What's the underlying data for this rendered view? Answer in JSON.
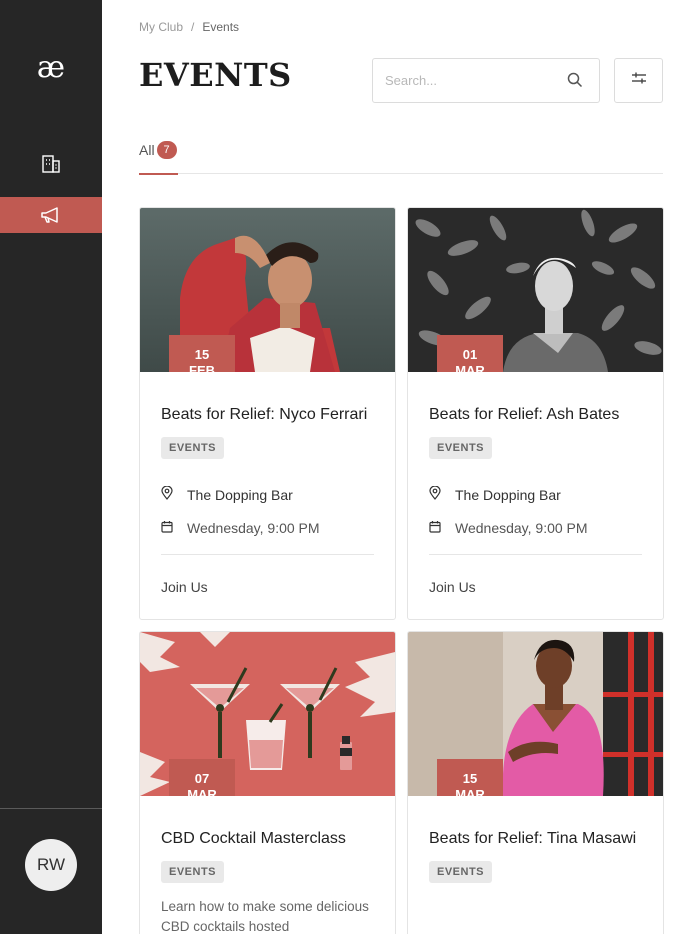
{
  "sidebar": {
    "logo": "æ",
    "nav": [
      {
        "id": "club",
        "icon": "building-icon",
        "active": false
      },
      {
        "id": "events",
        "icon": "megaphone-icon",
        "active": true
      }
    ],
    "avatar_initials": "RW"
  },
  "breadcrumb": {
    "parent": "My Club",
    "separator": "/",
    "current": "Events"
  },
  "header": {
    "title": "EVENTS"
  },
  "search": {
    "placeholder": "Search..."
  },
  "tabs": [
    {
      "label": "All",
      "count": "7",
      "active": true
    }
  ],
  "accent_color": "#c05a52",
  "cards": [
    {
      "day": "15",
      "month": "FEB",
      "title": "Beats for Relief: Nyco Ferrari",
      "tag": "EVENTS",
      "location": "The Dopping Bar",
      "time": "Wednesday, 9:00 PM",
      "cta": "Join Us"
    },
    {
      "day": "01",
      "month": "MAR",
      "title": "Beats for Relief: Ash Bates",
      "tag": "EVENTS",
      "location": "The Dopping Bar",
      "time": "Wednesday, 9:00 PM",
      "cta": "Join Us"
    },
    {
      "day": "07",
      "month": "MAR",
      "title": "CBD Cocktail Masterclass",
      "tag": "EVENTS",
      "description": "Learn how to make some delicious CBD cocktails hosted"
    },
    {
      "day": "15",
      "month": "MAR",
      "title": "Beats for Relief: Tina Masawi",
      "tag": "EVENTS"
    }
  ]
}
